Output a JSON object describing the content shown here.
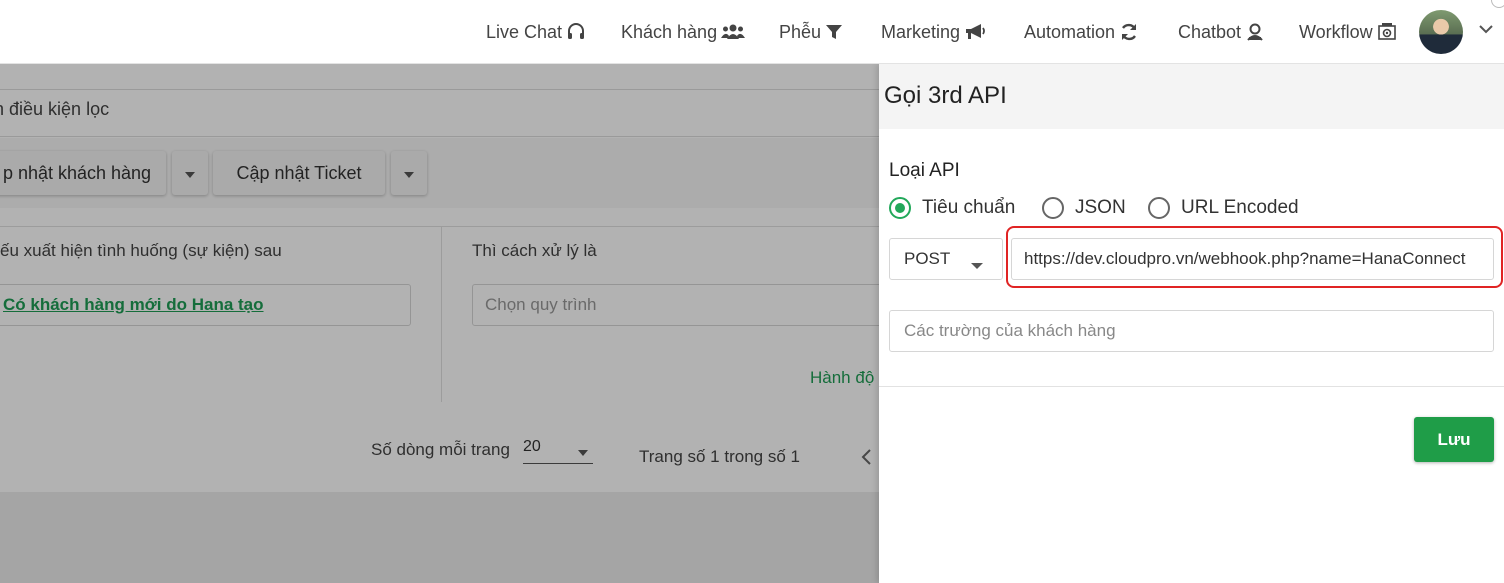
{
  "nav": {
    "items": [
      {
        "label": "Live Chat",
        "icon": "headset-icon"
      },
      {
        "label": "Khách hàng",
        "icon": "users-icon"
      },
      {
        "label": "Phễu",
        "icon": "funnel-icon"
      },
      {
        "label": "Marketing",
        "icon": "megaphone-icon"
      },
      {
        "label": "Automation",
        "icon": "refresh-icon"
      },
      {
        "label": "Chatbot",
        "icon": "bot-icon"
      },
      {
        "label": "Workflow",
        "icon": "workflow-icon"
      }
    ]
  },
  "background": {
    "filter_text": "n điều kiện lọc",
    "buttons": [
      "p nhật khách hàng",
      "Cập nhật Ticket"
    ],
    "left_col_label": "ếu xuất hiện tình huống (sự kiện) sau",
    "right_col_label": "Thì cách xử lý là",
    "trigger_value": "Có khách hàng mới do Hana tạo",
    "workflow_placeholder": "Chọn quy trình",
    "action_link": "Hành độ",
    "pager": {
      "rows_label": "Số dòng mỗi trang",
      "rows_value": "20",
      "page_text": "Trang số 1 trong số 1"
    }
  },
  "panel": {
    "title": "Gọi 3rd API",
    "api_type_label": "Loại API",
    "api_types": [
      {
        "label": "Tiêu chuẩn",
        "checked": true
      },
      {
        "label": "JSON",
        "checked": false
      },
      {
        "label": "URL Encoded",
        "checked": false
      }
    ],
    "method": "POST",
    "url_value": "https://dev.cloudpro.vn/webhook.php?name=HanaConnect",
    "fields_placeholder": "Các trường của khách hàng",
    "save_label": "Lưu"
  },
  "colors": {
    "accent_green": "#22a85a",
    "save_button": "#1f9d48",
    "highlight_red": "#e02424"
  }
}
